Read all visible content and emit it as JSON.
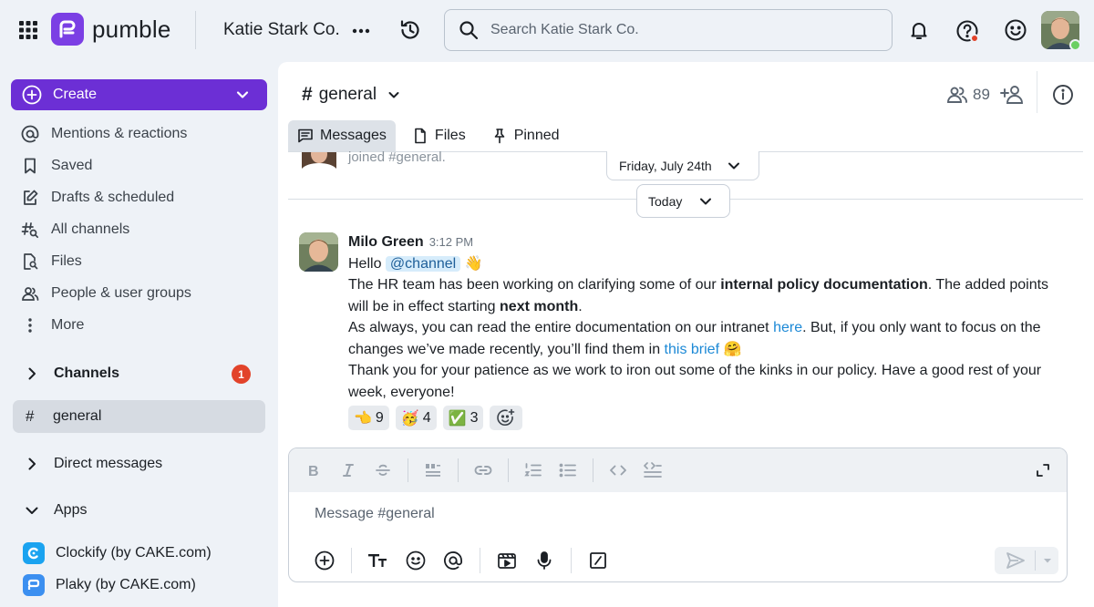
{
  "app": {
    "name": "pumble"
  },
  "workspace": {
    "name": "Katie Stark Co."
  },
  "search": {
    "placeholder": "Search Katie Stark Co."
  },
  "sidebar": {
    "create_label": "Create",
    "nav": [
      {
        "label": "Mentions & reactions",
        "icon": "at-icon"
      },
      {
        "label": "Saved",
        "icon": "bookmark-icon"
      },
      {
        "label": "Drafts & scheduled",
        "icon": "draft-icon"
      },
      {
        "label": "All channels",
        "icon": "hash-search-icon"
      },
      {
        "label": "Files",
        "icon": "file-search-icon"
      },
      {
        "label": "People & user groups",
        "icon": "people-icon"
      },
      {
        "label": "More",
        "icon": "more-vertical-icon"
      }
    ],
    "channels_label": "Channels",
    "channels_badge": "1",
    "active_channel": "general",
    "direct_messages_label": "Direct messages",
    "apps_label": "Apps",
    "apps": [
      {
        "label": "Clockify (by CAKE.com)",
        "color": "#1aa3f0"
      },
      {
        "label": "Plaky (by CAKE.com)",
        "color": "#3b8ff0"
      }
    ]
  },
  "channel": {
    "name": "general",
    "member_count": "89",
    "tabs": [
      "Messages",
      "Files",
      "Pinned"
    ],
    "prev_message_text": "joined #general.",
    "date_pill": "Friday, July 24th",
    "today_label": "Today"
  },
  "message": {
    "author": "Milo Green",
    "time": "3:12 PM",
    "hello": "Hello",
    "mention": "@channel",
    "p1_a": "The HR team has been working on clarifying some of our ",
    "p1_b": "internal policy documentation",
    "p1_c": ". The added points will be in effect starting ",
    "p1_d": "next month",
    "p1_e": ".",
    "p2_a": "As always, you can read the entire documentation on our intranet ",
    "p2_link1": "here",
    "p2_b": ". But, if you only want to focus on the changes we’ve made recently, you’ll find them in ",
    "p2_link2": "this brief",
    "p3": "Thank you for your patience as we work to iron out some of the kinks in our policy. Have a good rest of your week, everyone!",
    "reactions": [
      {
        "emoji": "👈",
        "count": "9"
      },
      {
        "emoji": "🥳",
        "count": "4"
      },
      {
        "emoji": "✅",
        "count": "3"
      }
    ]
  },
  "composer": {
    "placeholder": "Message #general"
  },
  "colors": {
    "brand": "#6c2fd5",
    "link": "#1c89d6",
    "badge": "#e2432a"
  }
}
